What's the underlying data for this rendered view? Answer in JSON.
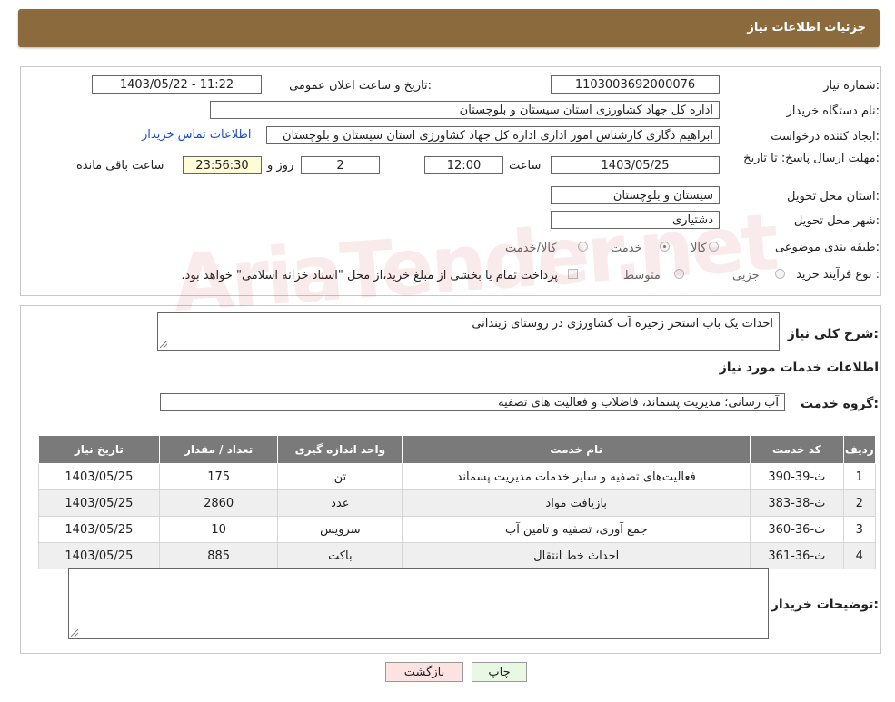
{
  "header": {
    "title": "جزئیات اطلاعات نیاز"
  },
  "details": {
    "need_number_label": "شماره نیاز:",
    "need_number": "1103003692000076",
    "announce_label": "تاریخ و ساعت اعلان عمومی:",
    "announce_value": "1403/05/22 - 11:22",
    "buyer_org_label": "نام دستگاه خریدار:",
    "buyer_org": "اداره کل جهاد کشاورزی استان سیستان و بلوچستان",
    "creator_label": "ایجاد کننده درخواست:",
    "creator": "ابراهیم دگاری کارشناس امور اداری اداره کل جهاد کشاورزی استان سیستان و بلوچستان",
    "contact_link": "اطلاعات تماس خریدار",
    "deadline_label": "مهلت ارسال پاسخ: تا تاریخ:",
    "deadline_date": "1403/05/25",
    "time_label": "ساعت",
    "deadline_time": "12:00",
    "days": "2",
    "days_label": "روز و",
    "remaining_time": "23:56:30",
    "remaining_label": "ساعت باقی مانده",
    "province_label": "استان محل تحویل:",
    "province": "سیستان و بلوچستان",
    "city_label": "شهر محل تحویل:",
    "city": "دشتیاری",
    "category_label": "طبقه بندی موضوعی:",
    "category_options": [
      "کالا",
      "خدمت",
      "کالا/خدمت"
    ],
    "purchase_type_label": "نوع فرآیند خرید :",
    "purchase_options": [
      "جزیی",
      "متوسط"
    ],
    "payment_note": "پرداخت تمام یا بخشی از مبلغ خرید،از محل \"اسناد خزانه اسلامی\" خواهد بود."
  },
  "summary": {
    "label": "شرح کلی نیاز:",
    "value": "احداث یک باب استخر زخیره آب کشاورزی در روستای زیندانی"
  },
  "services_section": {
    "title": "اطلاعات خدمات مورد نیاز",
    "group_label": "گروه خدمت:",
    "group_value": "آب رسانی؛ مدیریت پسماند، فاضلاب و فعالیت های تصفیه"
  },
  "table": {
    "headers": [
      "ردیف",
      "کد خدمت",
      "نام خدمت",
      "واحد اندازه گیری",
      "تعداد / مقدار",
      "تاریخ نیاز"
    ],
    "rows": [
      [
        "1",
        "ث-39-390",
        "فعالیت‌های تصفیه و سایر خدمات مدیریت پسماند",
        "تن",
        "175",
        "1403/05/25"
      ],
      [
        "2",
        "ث-38-383",
        "بازیافت مواد",
        "عدد",
        "2860",
        "1403/05/25"
      ],
      [
        "3",
        "ث-36-360",
        "جمع آوری، تصفیه و تامین آب",
        "سرویس",
        "10",
        "1403/05/25"
      ],
      [
        "4",
        "ث-36-361",
        "احداث خط انتقال",
        "باکت",
        "885",
        "1403/05/25"
      ]
    ]
  },
  "buyer_notes": {
    "label": "توضیحات خریدار:",
    "value": ""
  },
  "buttons": {
    "print": "چاپ",
    "back": "بازگشت"
  },
  "colors": {
    "header_bg": "#8b6b3e",
    "table_header_bg": "#7a7a7a",
    "print_bg": "#e9f8e3",
    "back_bg": "#fde2e2",
    "link": "#1a4fd0"
  },
  "watermark": "AriaTender.net"
}
